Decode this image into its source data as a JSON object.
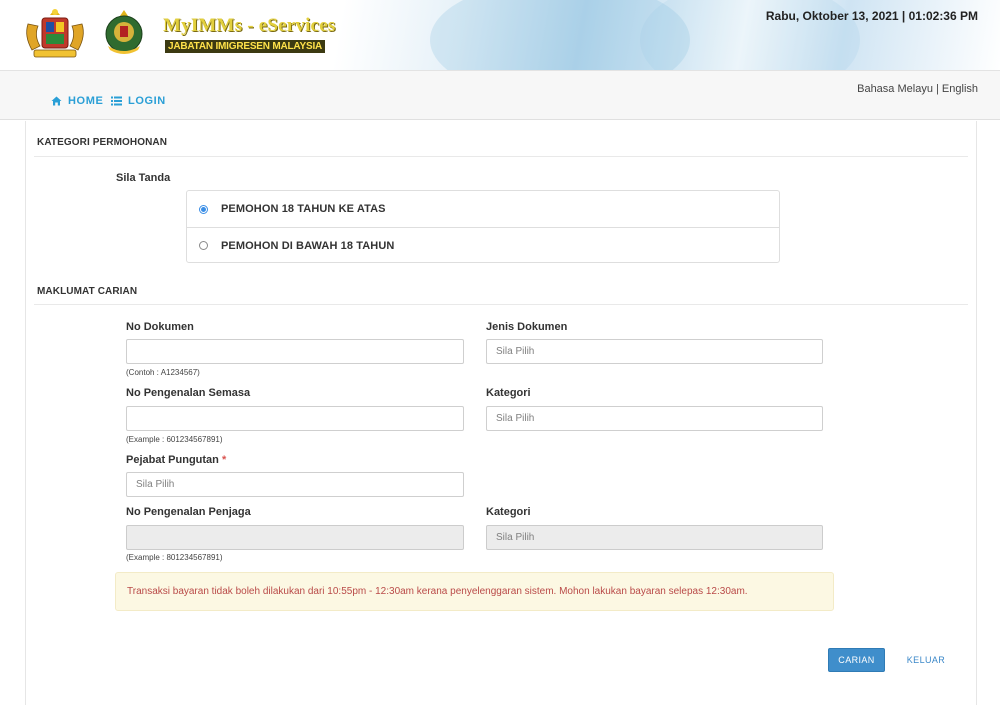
{
  "header": {
    "brand_title": "MyIMMs - eServices",
    "brand_subtitle": "JABATAN IMIGRESEN MALAYSIA",
    "datetime": "Rabu, Oktober 13, 2021 | 01:02:36 PM"
  },
  "nav": {
    "home": "HOME",
    "login": "LOGIN",
    "lang_malay": "Bahasa Melayu",
    "lang_separator": " | ",
    "lang_english": "English"
  },
  "kategori": {
    "title": "KATEGORI PERMOHONAN",
    "instruction": "Sila Tanda",
    "options": [
      {
        "label": "PEMOHON 18 TAHUN KE ATAS",
        "checked": true
      },
      {
        "label": "PEMOHON DI BAWAH 18 TAHUN",
        "checked": false
      }
    ]
  },
  "carian": {
    "title": "MAKLUMAT CARIAN",
    "no_dokumen": {
      "label": "No Dokumen",
      "value": "",
      "hint": "(Contoh : A1234567)"
    },
    "jenis_dokumen": {
      "label": "Jenis Dokumen",
      "value": "Sila Pilih"
    },
    "no_pengenalan": {
      "label": "No Pengenalan Semasa",
      "value": "",
      "hint": "(Example : 601234567891)"
    },
    "kategori": {
      "label": "Kategori",
      "value": "Sila Pilih"
    },
    "pejabat": {
      "label": "Pejabat Pungutan",
      "required_mark": "*",
      "value": "Sila Pilih"
    },
    "no_penjaga": {
      "label": "No Pengenalan Penjaga",
      "value": "",
      "hint": "(Example : 801234567891)"
    },
    "kategori_penjaga": {
      "label": "Kategori",
      "value": "Sila Pilih"
    }
  },
  "notice": "Transaksi bayaran tidak boleh dilakukan dari 10:55pm - 12:30am kerana penyelenggaran sistem. Mohon lakukan bayaran selepas 12:30am.",
  "buttons": {
    "carian": "CARIAN",
    "keluar": "KELUAR"
  },
  "colors": {
    "accent": "#2a9fd6",
    "primary_button": "#3f8ecb",
    "notice_bg": "#fcf8e3",
    "notice_text": "#b94a48",
    "required": "#d9534f"
  }
}
